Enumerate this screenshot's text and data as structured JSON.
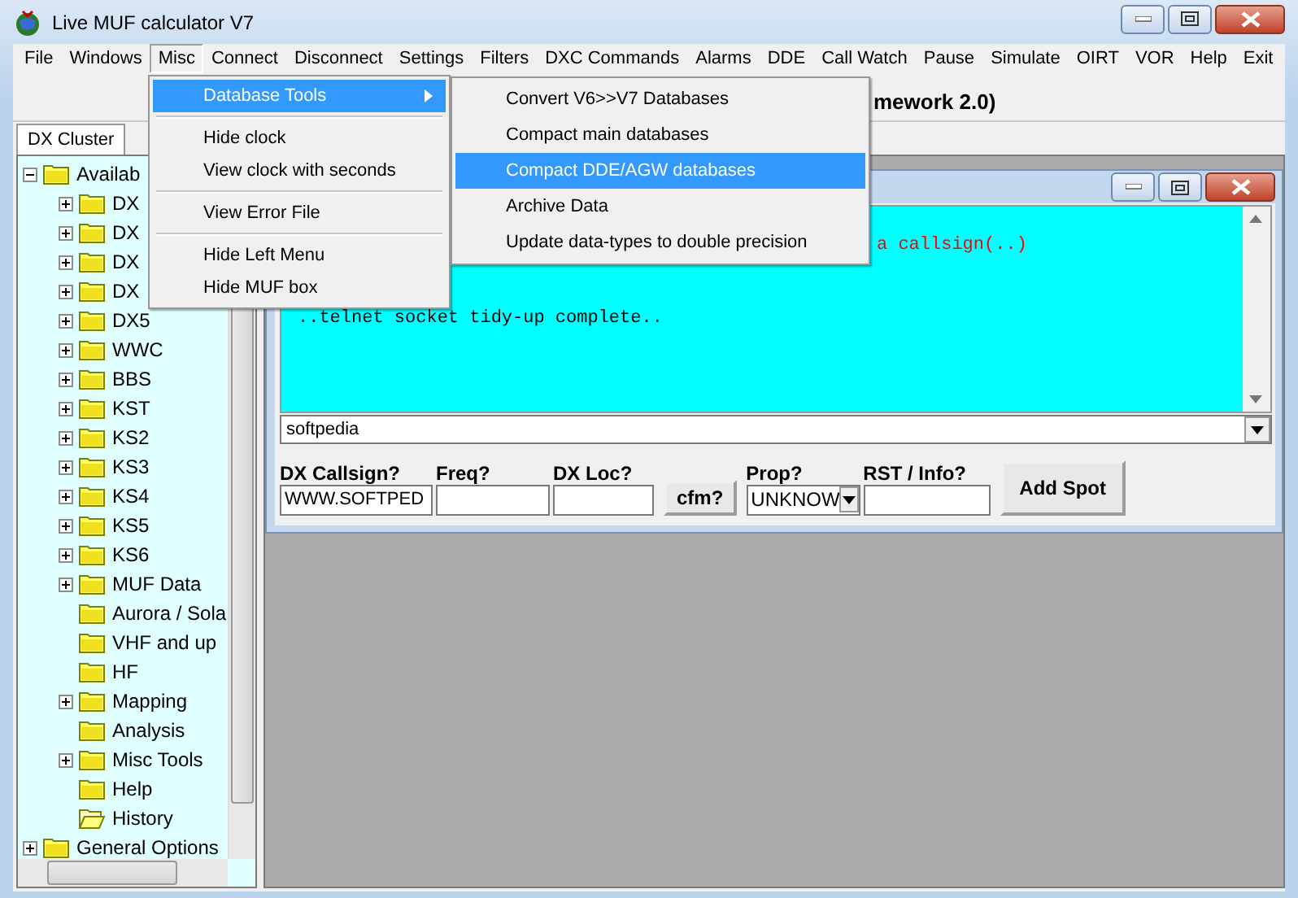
{
  "window": {
    "title": "Live MUF calculator V7"
  },
  "menu_bar": [
    {
      "label": "File",
      "selected": false
    },
    {
      "label": "Windows",
      "selected": false
    },
    {
      "label": "Misc",
      "selected": true
    },
    {
      "label": "Connect",
      "selected": false
    },
    {
      "label": "Disconnect",
      "selected": false
    },
    {
      "label": "Settings",
      "selected": false
    },
    {
      "label": "Filters",
      "selected": false
    },
    {
      "label": "DXC Commands",
      "selected": false
    },
    {
      "label": "Alarms",
      "selected": false
    },
    {
      "label": "DDE",
      "selected": false
    },
    {
      "label": "Call Watch",
      "selected": false
    },
    {
      "label": "Pause",
      "selected": false
    },
    {
      "label": "Simulate",
      "selected": false
    },
    {
      "label": "OIRT",
      "selected": false
    },
    {
      "label": "VOR",
      "selected": false
    },
    {
      "label": "Help",
      "selected": false
    },
    {
      "label": "Exit",
      "selected": false
    }
  ],
  "toolbar_text": "mework 2.0)",
  "tabs": [
    {
      "label": "DX Cluster",
      "selected": true
    }
  ],
  "tree": [
    {
      "label": "Availab",
      "kind": "branch",
      "expanded": true,
      "selected": false,
      "children": [
        {
          "label": "DX",
          "kind": "branch",
          "expanded": false,
          "selected": false
        },
        {
          "label": "DX",
          "kind": "branch",
          "expanded": false,
          "selected": false
        },
        {
          "label": "DX",
          "kind": "branch",
          "expanded": false,
          "selected": false
        },
        {
          "label": "DX",
          "kind": "branch",
          "expanded": false,
          "selected": false
        },
        {
          "label": "DX5",
          "kind": "branch",
          "expanded": false,
          "selected": false
        },
        {
          "label": "WWC",
          "kind": "branch",
          "expanded": false,
          "selected": false
        },
        {
          "label": "BBS",
          "kind": "branch",
          "expanded": false,
          "selected": false
        },
        {
          "label": "KST",
          "kind": "branch",
          "expanded": false,
          "selected": false
        },
        {
          "label": "KS2",
          "kind": "branch",
          "expanded": false,
          "selected": false
        },
        {
          "label": "KS3",
          "kind": "branch",
          "expanded": false,
          "selected": false
        },
        {
          "label": "KS4",
          "kind": "branch",
          "expanded": false,
          "selected": false
        },
        {
          "label": "KS5",
          "kind": "branch",
          "expanded": false,
          "selected": false
        },
        {
          "label": "KS6",
          "kind": "branch",
          "expanded": false,
          "selected": false
        },
        {
          "label": "MUF Data",
          "kind": "branch",
          "expanded": false,
          "selected": false
        },
        {
          "label": "Aurora / Sola",
          "kind": "leaf",
          "selected": false
        },
        {
          "label": "VHF and up",
          "kind": "leaf",
          "selected": false
        },
        {
          "label": "HF",
          "kind": "leaf",
          "selected": false
        },
        {
          "label": "Mapping",
          "kind": "branch",
          "expanded": false,
          "selected": false
        },
        {
          "label": "Analysis",
          "kind": "leaf",
          "selected": false
        },
        {
          "label": "Misc Tools",
          "kind": "branch",
          "expanded": false,
          "selected": false
        },
        {
          "label": "Help",
          "kind": "leaf",
          "selected": false
        },
        {
          "label": "History",
          "kind": "leaf",
          "selected": true
        }
      ]
    },
    {
      "label": "General Options",
      "kind": "branch",
      "expanded": false,
      "selected": false
    }
  ],
  "console": {
    "lines": [
      {
        "text": "a callsign(..)",
        "kind": "tail",
        "color": "#ff0000"
      },
      {
        "text": "..telnet socket tidy-up complete..",
        "kind": "full",
        "color": "#000000"
      }
    ],
    "input": {
      "value": "softpedia"
    }
  },
  "spot_form": {
    "fields": [
      {
        "label": "DX Callsign?",
        "kind": "text",
        "value": "WWW.SOFTPED"
      },
      {
        "label": "Freq?",
        "kind": "text"
      },
      {
        "label": "DX Loc?",
        "kind": "text"
      },
      {
        "kind": "button",
        "label": "cfm?"
      },
      {
        "label": "Prop?",
        "kind": "select",
        "value": "UNKNOW"
      },
      {
        "label": "RST / Info?",
        "kind": "text"
      },
      {
        "kind": "big_button",
        "label": "Add Spot"
      }
    ]
  },
  "misc_menu": {
    "items": [
      {
        "label": "Database Tools",
        "kind": "submenu",
        "selected": true
      },
      {
        "kind": "separator"
      },
      {
        "label": "Hide clock",
        "kind": "item",
        "selected": false
      },
      {
        "label": "View clock with seconds",
        "kind": "item",
        "selected": false
      },
      {
        "kind": "separator"
      },
      {
        "label": "View Error File",
        "kind": "item",
        "selected": false
      },
      {
        "kind": "separator"
      },
      {
        "label": "Hide Left Menu",
        "kind": "item",
        "selected": false
      },
      {
        "label": "Hide MUF box",
        "kind": "item",
        "selected": false
      }
    ]
  },
  "database_tools_menu": {
    "items": [
      {
        "label": "Convert V6>>V7 Databases",
        "selected": false
      },
      {
        "label": "Compact main databases",
        "selected": false
      },
      {
        "label": "Compact DDE/AGW databases",
        "selected": true
      },
      {
        "label": "Archive Data",
        "selected": false
      },
      {
        "label": "Update data-types to double precision",
        "selected": false
      }
    ]
  }
}
